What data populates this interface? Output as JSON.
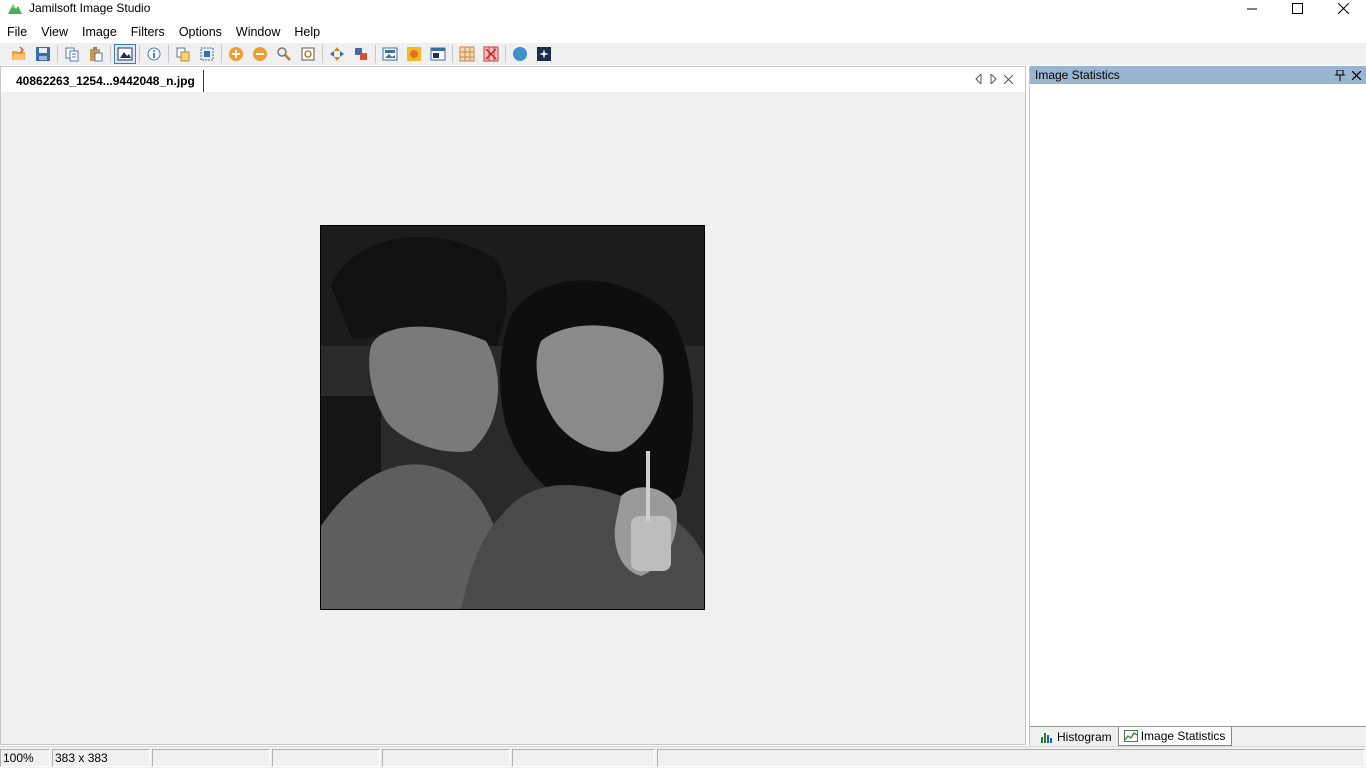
{
  "window": {
    "title": "Jamilsoft Image Studio"
  },
  "menu": {
    "items": [
      {
        "label": "File"
      },
      {
        "label": "View"
      },
      {
        "label": "Image"
      },
      {
        "label": "Filters"
      },
      {
        "label": "Options"
      },
      {
        "label": "Window"
      },
      {
        "label": "Help"
      }
    ]
  },
  "toolbar": {
    "buttons": [
      {
        "icon": "open-folder-icon"
      },
      {
        "icon": "save-icon"
      },
      {
        "icon": "copy-icon"
      },
      {
        "icon": "paste-icon"
      },
      {
        "icon": "image-view-icon"
      },
      {
        "icon": "info-icon"
      },
      {
        "icon": "duplicate-icon"
      },
      {
        "icon": "select-icon"
      },
      {
        "icon": "zoom-in-icon"
      },
      {
        "icon": "zoom-out-icon"
      },
      {
        "icon": "magnifier-icon"
      },
      {
        "icon": "fit-icon"
      },
      {
        "icon": "move-icon"
      },
      {
        "icon": "resize-icon"
      },
      {
        "icon": "picture-icon"
      },
      {
        "icon": "effect-icon"
      },
      {
        "icon": "window-icon"
      },
      {
        "icon": "grid-icon"
      },
      {
        "icon": "grid-red-icon"
      },
      {
        "icon": "globe-icon"
      },
      {
        "icon": "sparkle-icon"
      }
    ]
  },
  "document": {
    "tab_label": "40862263_1254...9442048_n.jpg"
  },
  "panel": {
    "title": "Image Statistics",
    "tabs": [
      {
        "label": "Histogram"
      },
      {
        "label": "Image Statistics"
      }
    ]
  },
  "status": {
    "zoom": "100%",
    "dimensions": "383 x 383"
  },
  "colors": {
    "panel_header": "#99b4d1",
    "accent": "#3c7fb1"
  }
}
